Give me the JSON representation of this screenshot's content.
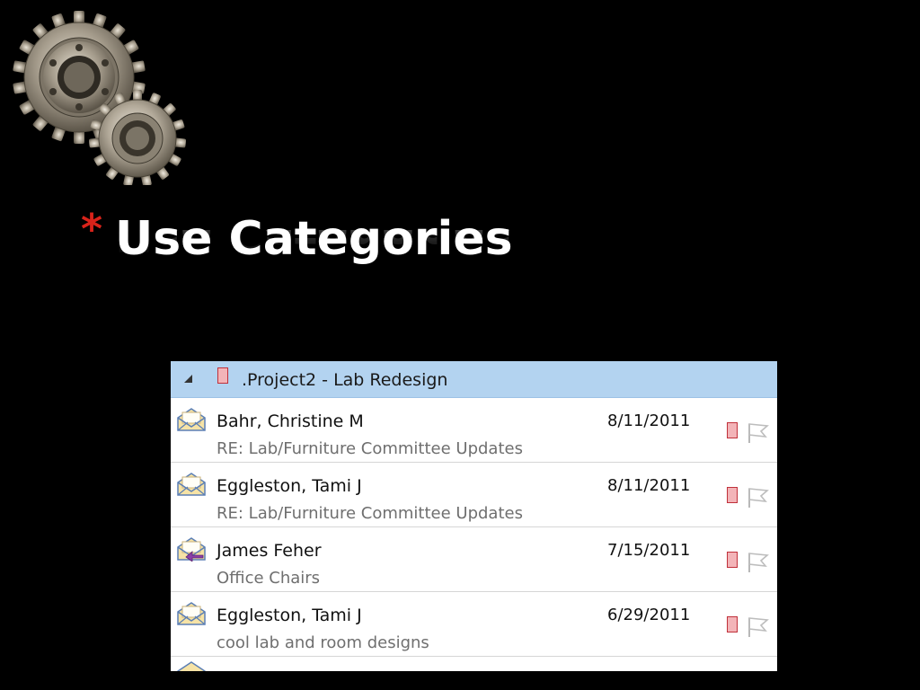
{
  "slide": {
    "title_bullet": "*",
    "title": "Use Categories",
    "logo_icon": "gears-icon"
  },
  "mail_list": {
    "group": {
      "label": ".Project2 - Lab Redesign",
      "category_color": "#c0303a"
    },
    "messages": [
      {
        "sender": "Bahr, Christine M",
        "subject": "RE: Lab/Furniture Committee Updates",
        "date": "8/11/2011",
        "icon": "envelope-open-icon",
        "replied": false
      },
      {
        "sender": "Eggleston, Tami J",
        "subject": "RE: Lab/Furniture Committee Updates",
        "date": "8/11/2011",
        "icon": "envelope-open-icon",
        "replied": false
      },
      {
        "sender": "James Feher",
        "subject": "Office Chairs",
        "date": "7/15/2011",
        "icon": "envelope-replied-icon",
        "replied": true
      },
      {
        "sender": "Eggleston, Tami J",
        "subject": "cool lab and room designs",
        "date": "6/29/2011",
        "icon": "envelope-open-icon",
        "replied": false
      }
    ]
  },
  "colors": {
    "background": "#000000",
    "title_text": "#ffffff",
    "bullet": "#d8231a",
    "group_header_bg": "#b3d3f0",
    "category_fill": "#f3b4b8"
  }
}
